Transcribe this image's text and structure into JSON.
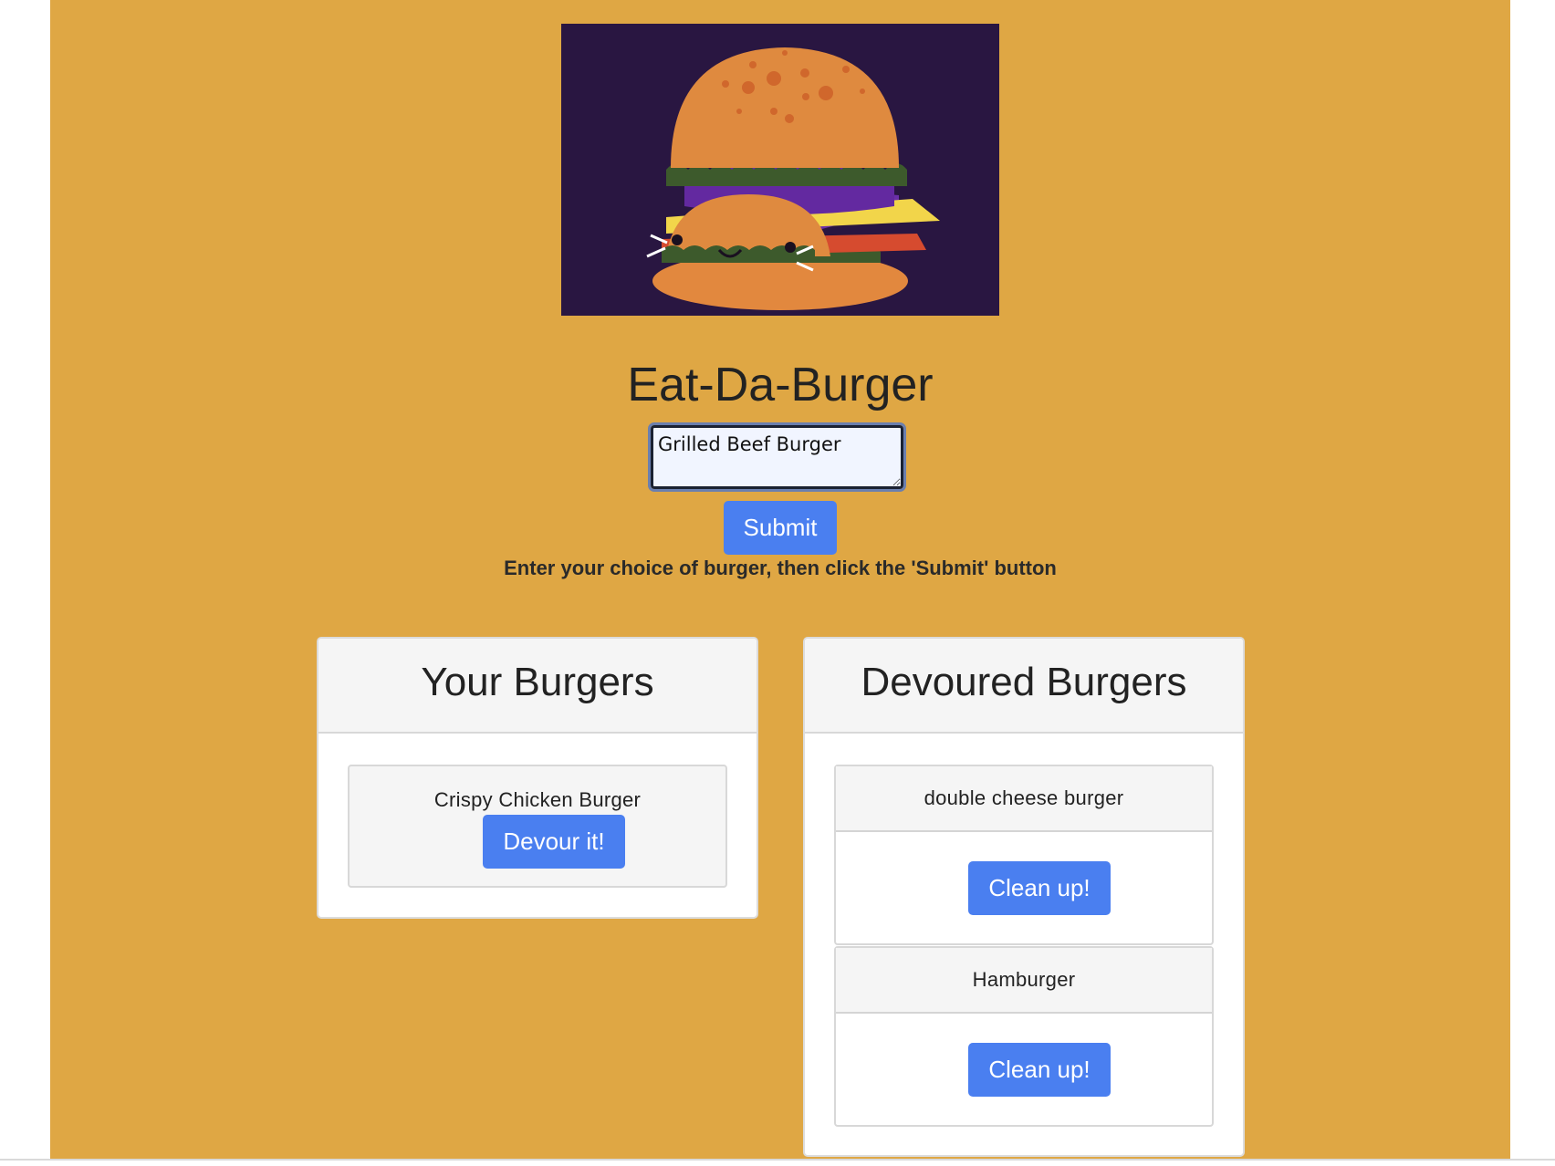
{
  "app": {
    "title": "Eat-Da-Burger"
  },
  "form": {
    "input_value": "Grilled Beef Burger",
    "submit_label": "Submit",
    "hint": "Enter your choice of burger, then click the 'Submit' button"
  },
  "your_burgers": {
    "heading": "Your Burgers",
    "items": [
      {
        "name": "Crispy Chicken Burger",
        "action": "Devour it!"
      }
    ]
  },
  "devoured_burgers": {
    "heading": "Devoured Burgers",
    "items": [
      {
        "name": "double cheese burger",
        "action": "Clean up!"
      },
      {
        "name": "Hamburger",
        "action": "Clean up!"
      }
    ]
  },
  "colors": {
    "page_background": "#dfa744",
    "button": "#4a7ff0",
    "hero_background": "#291641"
  },
  "icons": {
    "hero": "cute-burger-illustration"
  }
}
